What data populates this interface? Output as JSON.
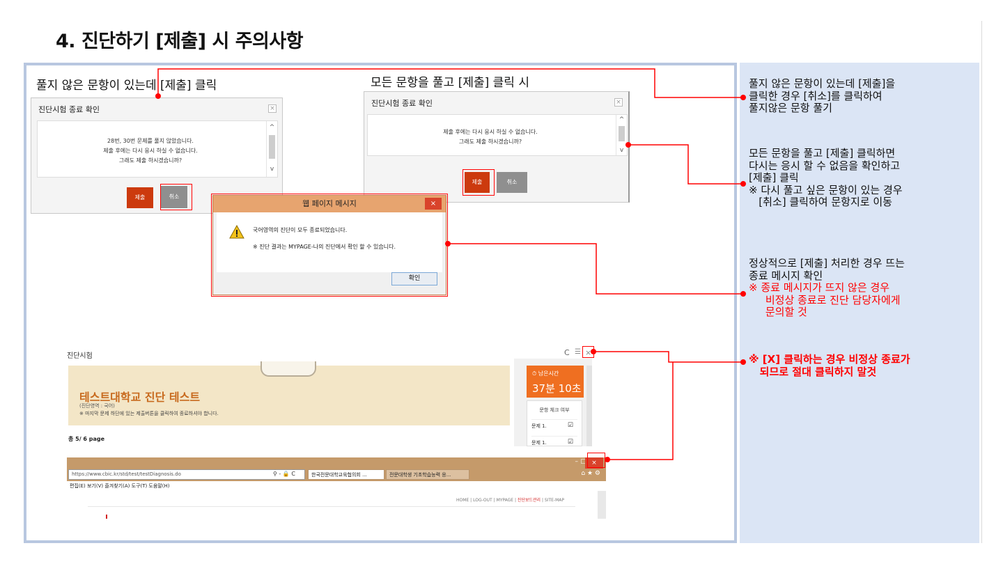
{
  "heading": "4. 진단하기 [제출] 시 주의사항",
  "captions": {
    "left": "풀지 않은 문항이 있는데 [제출] 클릭",
    "right": "모든 문항을 풀고 [제출] 클릭 시"
  },
  "dialog_unanswered": {
    "title": "진단시험 종료 확인",
    "close": "×",
    "line1": "28번, 30번 문제를 풀지 않았습니다.",
    "line2": "제출 후에는 다시 응시 하실 수 없습니다.",
    "line3": "그래도 제출 하시겠습니까?",
    "submit": "제출",
    "cancel": "취소"
  },
  "dialog_all_answered": {
    "title": "진단시험 종료 확인",
    "close": "×",
    "line1": "제출 후에는 다시 응시 하실 수 없습니다.",
    "line2": "그래도 제출 하시겠습니까?",
    "submit": "제출",
    "cancel": "취소"
  },
  "web_message": {
    "title": "웹 페이지 메시지",
    "close": "×",
    "line1": "국어영역의 진단이 모두 종료되었습니다.",
    "line2": "※ 진단 결과는 MYPAGE-나의 진단에서 확인 할 수 있습니다.",
    "ok": "확인",
    "icon": "warning-icon"
  },
  "exam": {
    "window_title": "진단시험",
    "title": "테스트대학교 진단 테스트",
    "subtitle": "(진단영역 : 국어)",
    "note": "※ 마지막 문제 하단에 있는 제출버튼을 클릭하여 종료하셔야 합니다.",
    "page_info": "총 5/ 6 page",
    "timer_label": "남은시간",
    "timer_value": "37분 10초",
    "check_header": "문항 체크 여부",
    "check_rows": [
      "문제 1.",
      "문제 1."
    ],
    "close": "×",
    "refresh": "C"
  },
  "browser": {
    "url": "https://www.cbic.kr/std/test/testDiagnosis.do",
    "tab1": "한국전문대학교육협의회 ...",
    "tab2": "전문대학생 기초학습능력 응...",
    "menu": "편집(E)  보기(V)  즐겨찾기(A)  도구(T)  도움말(H)",
    "nav_items": [
      "HOME",
      "LOG-OUT",
      "MYPAGE"
    ],
    "nav_highlight": "진단보드관리",
    "nav_last": "SITE-MAP",
    "close": "×",
    "minimize": "–",
    "maximize": "□"
  },
  "notes": {
    "n1": "풀지 않은 문항이 있는데 [제출]을\n클릭한 경우 [취소]를 클릭하여\n풀지않은 문항 풀기",
    "n2": "모든 문항을 풀고 [제출] 클릭하면\n다시는 응시 할 수 없음을 확인하고\n[제출] 클릭\n※ 다시 풀고 싶은 문항이 있는 경우\n   [취소] 클릭하여 문항지로 이동",
    "n3": "정상적으로 [제출] 처리한 경우 뜨는\n종료 메시지 확인",
    "n3_red": "※ 종료 메시지가 뜨지 않은 경우\n     비정상 종료로 진단 담당자에게\n     문의할 것",
    "n4": "※ [X] 클릭하는 경우 비정상 종료가\n   되므로 절대 클릭하지 말것"
  },
  "colors": {
    "frame": "#b8c7e0",
    "panel": "#dbe5f5",
    "alert": "#ff0000",
    "submit": "#cc3a0e",
    "timer": "#ef6f21"
  }
}
